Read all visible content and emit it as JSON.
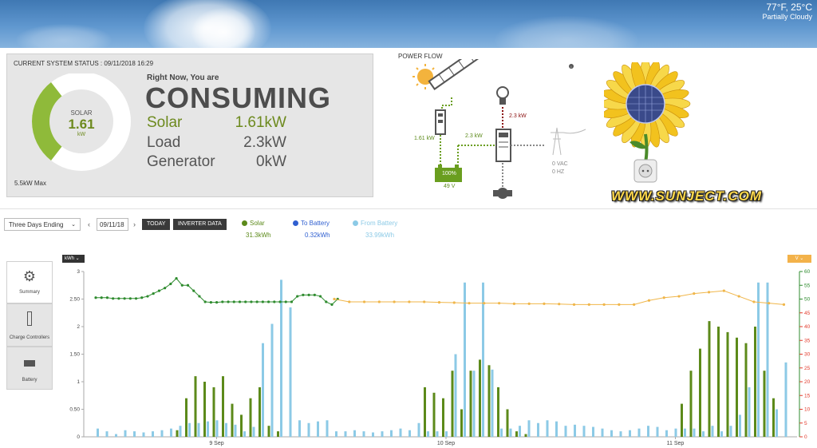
{
  "weather": {
    "temperature": "77°F, 25°C",
    "condition": "Partially Cloudy"
  },
  "status": {
    "title": "CURRENT SYSTEM STATUS : 09/11/2018 16:29",
    "gauge": {
      "label": "SOLAR",
      "value": "1.61",
      "unit": "kW",
      "fraction": 0.29
    },
    "max_label": "5.5kW Max",
    "now_label": "Right Now, You are",
    "mode": "CONSUMING",
    "rows": [
      {
        "label": "Solar",
        "value": "1.61kW",
        "color": "#6d8a1e"
      },
      {
        "label": "Load",
        "value": "2.3kW",
        "color": "#555555"
      },
      {
        "label": "Generator",
        "value": "0kW",
        "color": "#555555"
      }
    ]
  },
  "power_flow": {
    "title": "POWER FLOW",
    "info_icon": "i",
    "solar_kw": "1.61 kW",
    "battery_flow_kw": "2.3 kW",
    "load_kw": "2.3 kW",
    "battery_percent": "100%",
    "battery_volts": "49 V",
    "grid_vac": "0 VAC",
    "grid_hz": "0 HZ"
  },
  "logo": {
    "site": "WWW.SUNJECT.COM"
  },
  "controls": {
    "range_label": "Three Days Ending",
    "date": "09/11/18",
    "prev_icon": "‹",
    "next_icon": "›",
    "today_label": "TODAY",
    "inverter_label": "INVERTER DATA"
  },
  "legend": [
    {
      "name": "Solar",
      "value": "31.3kWh",
      "color": "#5c8a1a"
    },
    {
      "name": "To Battery",
      "value": "0.32kWh",
      "color": "#2f5fd0"
    },
    {
      "name": "From Battery",
      "value": "33.99kWh",
      "color": "#8ccae6"
    }
  ],
  "tabs": [
    {
      "label": "Summary",
      "icon": "gear-icon"
    },
    {
      "label": "Charge Controllers",
      "icon": "charge-controller-icon"
    },
    {
      "label": "Battery",
      "icon": "battery-icon"
    }
  ],
  "unit_selector": "kWh ⌄",
  "v_selector": "V ⌄",
  "chart_data": {
    "type": "bar",
    "x_tick_labels": [
      "9 Sep",
      "10 Sep",
      "11 Sep"
    ],
    "x_tick_indices": [
      13,
      38,
      63
    ],
    "y_left": {
      "ticks": [
        "0",
        "0.50",
        "1",
        "1.50",
        "2",
        "2.50",
        "3"
      ],
      "range": [
        0,
        3
      ]
    },
    "y_right": {
      "ticks": [
        "0",
        "5",
        "10",
        "15",
        "20",
        "25",
        "30",
        "35",
        "40",
        "45",
        "50",
        "55",
        "60"
      ],
      "range": [
        0,
        60
      ]
    },
    "series": [
      {
        "name": "Solar",
        "color": "#5c8a1a",
        "values": [
          0,
          0,
          0,
          0,
          0,
          0,
          0,
          0,
          0,
          0.12,
          0.7,
          1.1,
          1,
          0.9,
          1.1,
          0.6,
          0.4,
          0.7,
          0.9,
          0.2,
          0.1,
          0,
          0,
          0,
          0,
          0,
          0,
          0,
          0,
          0,
          0,
          0,
          0,
          0,
          0,
          0,
          0.9,
          0.8,
          0.7,
          1.2,
          0.5,
          1.2,
          1.4,
          1.3,
          0.9,
          0.5,
          0.1,
          0.05,
          0,
          0,
          0,
          0,
          0,
          0,
          0,
          0,
          0,
          0,
          0,
          0,
          0,
          0,
          0,
          0,
          0.6,
          1.2,
          1.6,
          2.1,
          2.0,
          1.9,
          1.8,
          1.7,
          2.0,
          1.2,
          0.7,
          0
        ]
      },
      {
        "name": "From Battery",
        "color": "#8ccae6",
        "values": [
          0.15,
          0.1,
          0.05,
          0.12,
          0.1,
          0.08,
          0.1,
          0.12,
          0.15,
          0.2,
          0.25,
          0.25,
          0.28,
          0.3,
          0.25,
          0.22,
          0.1,
          0.18,
          1.7,
          2.05,
          2.85,
          2.35,
          0.3,
          0.25,
          0.28,
          0.3,
          0.1,
          0.1,
          0.12,
          0.1,
          0.08,
          0.1,
          0.12,
          0.15,
          0.12,
          0.25,
          0.1,
          0.1,
          0.1,
          1.5,
          2.8,
          1.2,
          2.8,
          1.22,
          0.15,
          0.15,
          0.2,
          0.3,
          0.25,
          0.3,
          0.28,
          0.2,
          0.22,
          0.2,
          0.18,
          0.15,
          0.12,
          0.1,
          0.12,
          0.15,
          0.2,
          0.18,
          0.12,
          0.15,
          0.15,
          0.15,
          0.1,
          0.2,
          0.1,
          0.2,
          0.4,
          0.9,
          2.8,
          2.8,
          0.5,
          1.35
        ]
      },
      {
        "name": "Voltage",
        "color": "#2e8b2e",
        "axis": "right",
        "values": [
          50.5,
          50.5,
          50.5,
          50.2,
          50.2,
          50.2,
          50.2,
          50.2,
          50.5,
          51,
          52,
          53,
          54,
          55.5,
          57.5,
          55,
          55,
          53,
          51,
          49,
          48.8,
          48.8,
          49,
          49,
          49,
          49,
          49,
          49,
          49,
          49,
          49,
          49,
          49,
          49,
          49,
          51,
          51.5,
          51.5,
          51.5,
          51,
          49,
          48,
          50
        ]
      },
      {
        "name": "Voltage idle",
        "color": "#f0b64a",
        "axis": "right",
        "values": [
          50,
          49,
          49,
          49,
          49,
          49,
          49,
          48.8,
          48.7,
          48.5,
          48.5,
          48.5,
          48.3,
          48.3,
          48.3,
          48.2,
          48,
          48,
          48,
          48,
          48,
          49.5,
          50.5,
          51,
          52,
          52.5,
          53,
          51,
          49,
          48.5,
          48
        ]
      }
    ]
  }
}
